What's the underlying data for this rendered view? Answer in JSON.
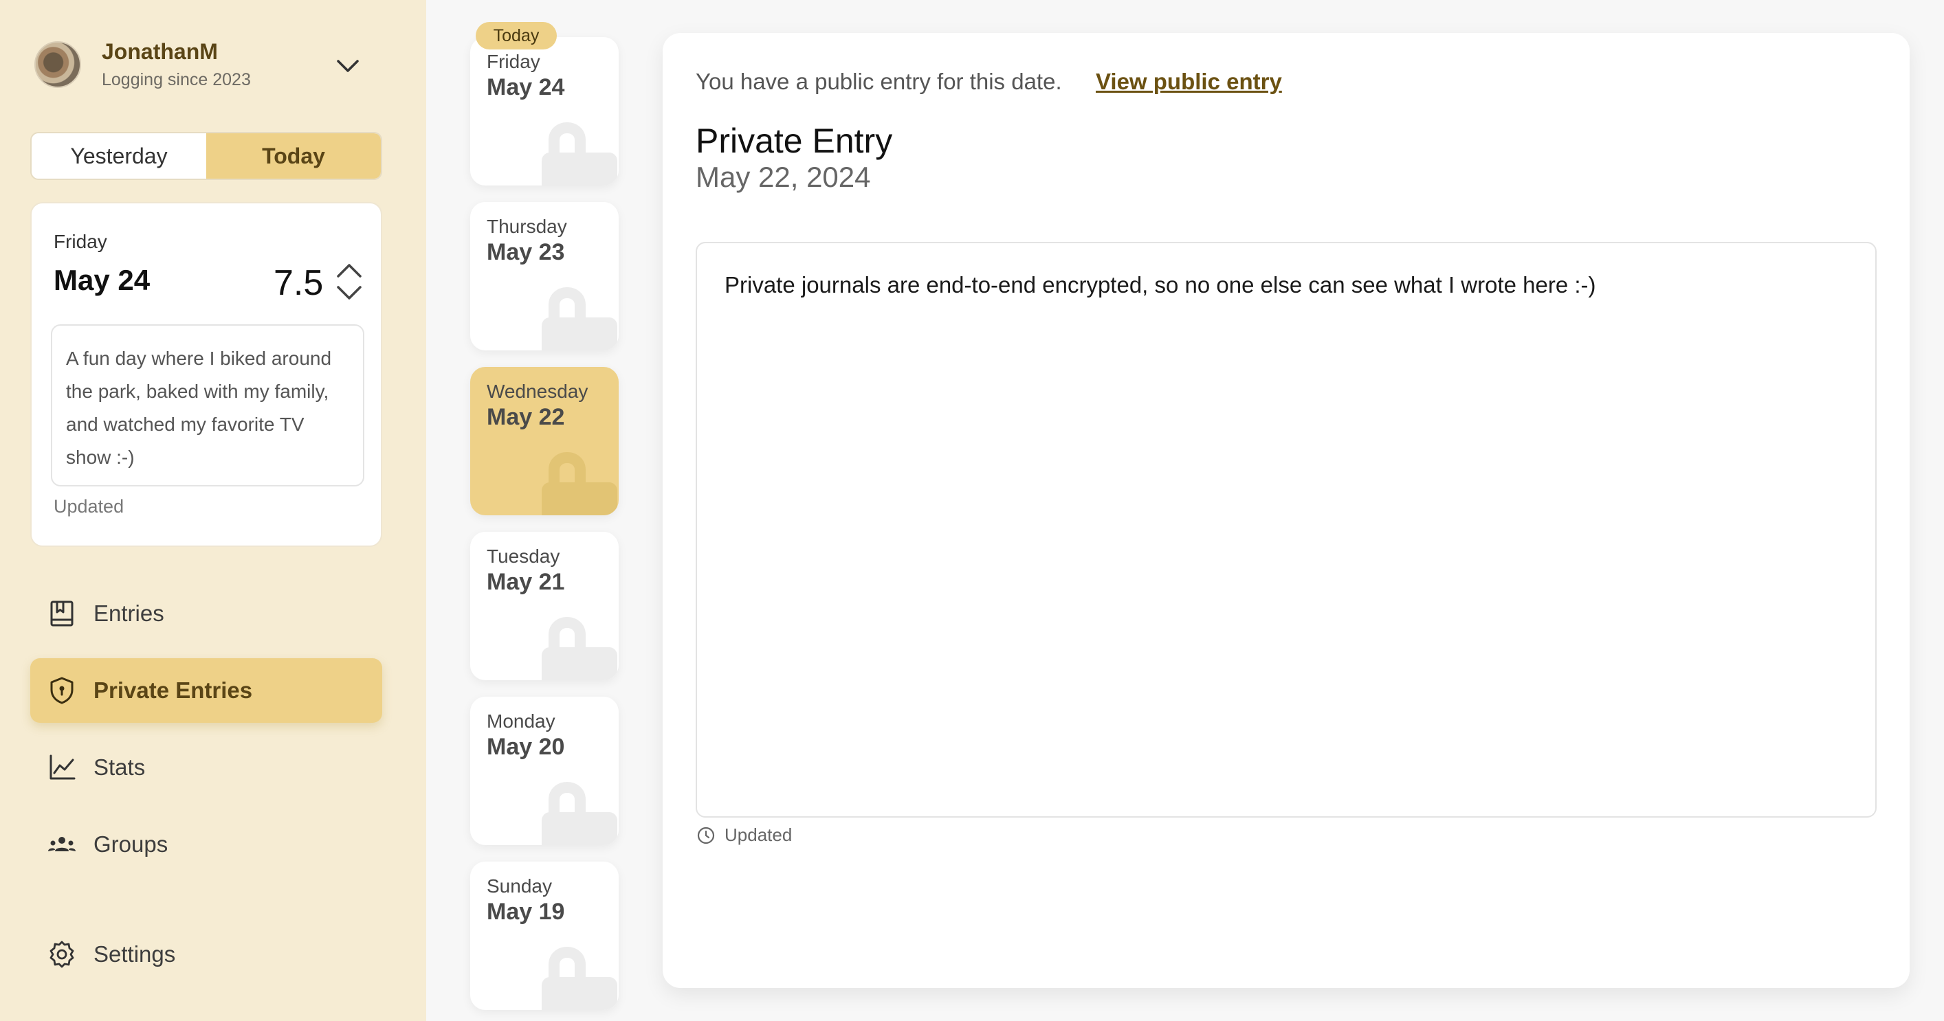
{
  "user": {
    "name": "JonathanM",
    "subtitle": "Logging since 2023"
  },
  "day_toggle": {
    "yesterday": "Yesterday",
    "today": "Today",
    "active": "today"
  },
  "today_card": {
    "weekday": "Friday",
    "date": "May 24",
    "score": "7.5",
    "note": "A fun day where I biked around the park, baked with my family, and watched my favorite TV show :-)",
    "updated": "Updated"
  },
  "nav": {
    "entries": "Entries",
    "private_entries": "Private Entries",
    "stats": "Stats",
    "groups": "Groups",
    "settings": "Settings",
    "active": "private_entries"
  },
  "date_strip": {
    "today_badge": "Today",
    "days": [
      {
        "weekday": "Friday",
        "date": "May 24"
      },
      {
        "weekday": "Thursday",
        "date": "May 23"
      },
      {
        "weekday": "Wednesday",
        "date": "May 22"
      },
      {
        "weekday": "Tuesday",
        "date": "May 21"
      },
      {
        "weekday": "Monday",
        "date": "May 20"
      },
      {
        "weekday": "Sunday",
        "date": "May 19"
      }
    ],
    "selected_index": 2
  },
  "main": {
    "public_note": "You have a public entry for this date.",
    "public_link": "View public entry",
    "title": "Private Entry",
    "date": "May 22, 2024",
    "body": "Private journals are end-to-end encrypted, so no one else can see what I wrote here :-)",
    "updated": "Updated"
  },
  "colors": {
    "accent": "#eed188",
    "sidebar_bg": "#f6ecd3",
    "brand_text": "#5a4516"
  }
}
